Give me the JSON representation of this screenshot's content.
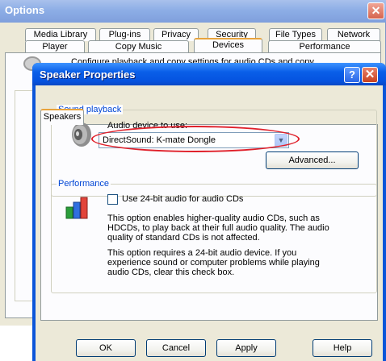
{
  "options_window": {
    "title": "Options",
    "close_glyph": "✕",
    "tabs_row1": [
      "Media Library",
      "Plug-ins",
      "Privacy",
      "Security",
      "File Types",
      "Network"
    ],
    "tabs_row2": [
      "Player",
      "Copy Music",
      "Devices",
      "Performance"
    ],
    "active_tab": "Devices",
    "description_partial": "Configure playback and copy settings for audio CDs and copy"
  },
  "dialog": {
    "title": "Speaker Properties",
    "help_glyph": "?",
    "close_glyph": "✕",
    "tab": "Speakers",
    "sound_playback": {
      "group_label": "Sound playback",
      "device_label": "Audio device to use:",
      "device_value": "DirectSound: K-mate Dongle",
      "advanced_button": "Advanced..."
    },
    "performance": {
      "group_label": "Performance",
      "checkbox_label": "Use 24-bit audio for audio CDs",
      "checkbox_checked": false,
      "paragraph1": "This option enables higher-quality audio CDs, such as HDCDs, to play back at their full audio quality. The audio quality of standard CDs is not affected.",
      "paragraph2": "This option requires a 24-bit audio device. If you experience sound or computer problems while playing audio CDs, clear this check box."
    },
    "buttons": {
      "ok": "OK",
      "cancel": "Cancel",
      "apply": "Apply",
      "help": "Help"
    }
  },
  "colors": {
    "titlebar_blue": "#0553e0",
    "highlight_oval": "#e0202a",
    "group_label": "#0046d5",
    "dialog_face": "#ece9d8"
  }
}
